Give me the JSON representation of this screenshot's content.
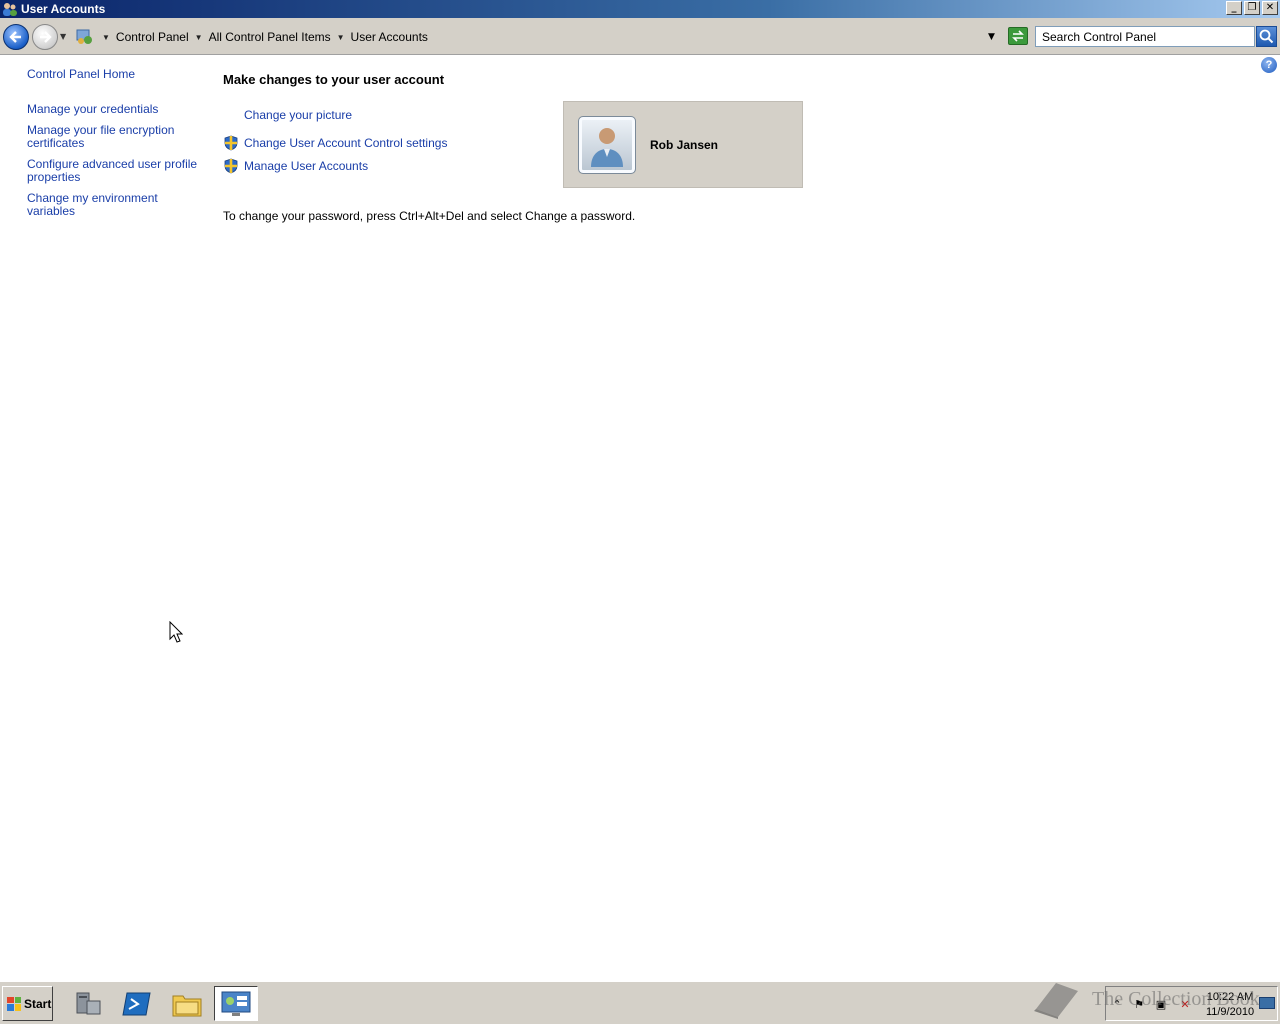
{
  "window": {
    "title": "User Accounts",
    "minimize": "_",
    "restore": "❐",
    "close": "✕"
  },
  "address_bar": {
    "breadcrumbs": [
      "Control Panel",
      "All Control Panel Items",
      "User Accounts"
    ],
    "search_placeholder": "Search Control Panel"
  },
  "help": {
    "label": "?"
  },
  "sidebar": {
    "home": "Control Panel Home",
    "items": [
      {
        "line1": "Manage your credentials",
        "line2": ""
      },
      {
        "line1": "Manage your file encryption",
        "line2": "certificates"
      },
      {
        "line1": "Configure advanced user profile",
        "line2": "properties"
      },
      {
        "line1": "Change my environment variables",
        "line2": ""
      }
    ]
  },
  "main": {
    "heading": "Make changes to your user account",
    "tasks": [
      {
        "label": "Change your picture",
        "icon": "none"
      },
      {
        "label": "Change User Account Control settings",
        "icon": "uac-shield-icon"
      },
      {
        "label": "Manage User Accounts",
        "icon": "uac-shield-icon"
      }
    ],
    "password_note": "To change your password, press Ctrl+Alt+Del and select Change a password.",
    "account": {
      "name": "Rob Jansen"
    }
  },
  "taskbar": {
    "start_label": "Start",
    "apps": [
      "server-manager-icon",
      "powershell-icon",
      "windows-explorer-icon",
      "control-panel-icon"
    ],
    "clock": {
      "time": "10:22 AM",
      "date": "11/9/2010"
    }
  },
  "watermark": "The Collection Book",
  "colors": {
    "link": "#1a3ea8",
    "titlebar": "#0a246a",
    "chrome": "#d4d0c8"
  }
}
